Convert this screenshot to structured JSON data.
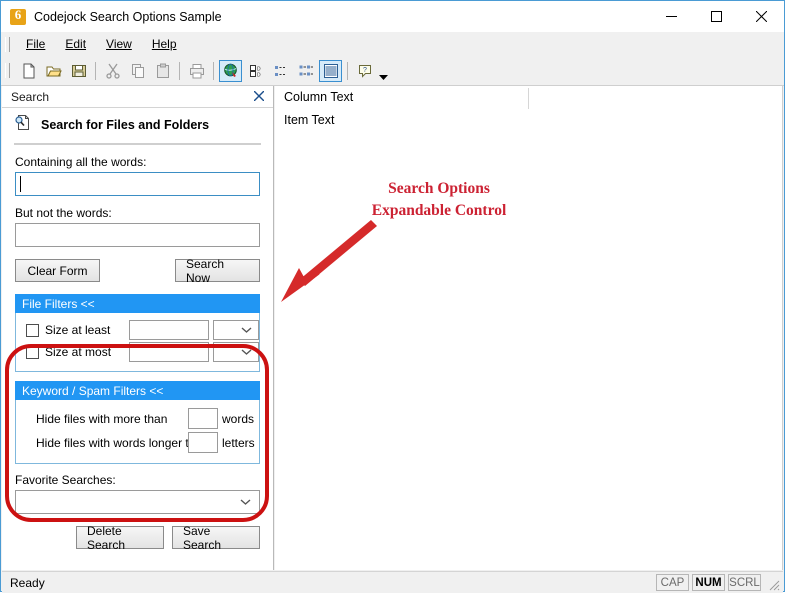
{
  "window": {
    "title": "Codejock Search Options Sample",
    "app_icon": "codejock-logo-icon",
    "minimize_label": "Minimize",
    "maximize_label": "Maximize",
    "close_label": "Close"
  },
  "menubar": {
    "items": [
      {
        "label": "File",
        "accel": "F"
      },
      {
        "label": "Edit",
        "accel": "E"
      },
      {
        "label": "View",
        "accel": "V"
      },
      {
        "label": "Help",
        "accel": "H"
      }
    ]
  },
  "toolbar": {
    "buttons": [
      {
        "name": "new-icon",
        "title": "New"
      },
      {
        "name": "open-icon",
        "title": "Open"
      },
      {
        "name": "save-icon",
        "title": "Save"
      },
      {
        "name": "cut-icon",
        "title": "Cut"
      },
      {
        "name": "copy-icon",
        "title": "Copy"
      },
      {
        "name": "paste-icon",
        "title": "Paste"
      },
      {
        "name": "print-icon",
        "title": "Print"
      },
      {
        "name": "globe-icon",
        "title": "Web"
      },
      {
        "name": "large-icons-icon",
        "title": "Large Icons"
      },
      {
        "name": "small-icons-icon",
        "title": "Small Icons"
      },
      {
        "name": "list-icon",
        "title": "List"
      },
      {
        "name": "details-icon",
        "title": "Details"
      },
      {
        "name": "help-icon",
        "title": "Help"
      }
    ],
    "dropdown_label": "More"
  },
  "search_pane": {
    "caption": "Search",
    "close_label": "Close",
    "header_title": "Search for Files and Folders",
    "header_icon": "search-document-icon",
    "containing_label": "Containing all the words:",
    "containing_value": "",
    "not_words_label": "But not the words:",
    "not_words_value": "",
    "clear_form_label": "Clear Form",
    "search_now_label": "Search Now",
    "file_filters": {
      "title": "File Filters <<",
      "rows": [
        {
          "label": "Size at least",
          "checked": false,
          "value": "",
          "unit": ""
        },
        {
          "label": "Size at most",
          "checked": false,
          "value": "",
          "unit": ""
        }
      ]
    },
    "keyword_filters": {
      "title": "Keyword / Spam Filters <<",
      "rows": [
        {
          "label": "Hide files with more than",
          "value": "",
          "unit": "words"
        },
        {
          "label": "Hide files with words longer than",
          "value": "",
          "unit": "letters"
        }
      ]
    },
    "favorites_label": "Favorite Searches:",
    "favorites_value": "",
    "delete_search_label": "Delete Search",
    "save_search_label": "Save Search"
  },
  "content": {
    "column_text": "Column Text",
    "item_text": "Item Text",
    "annotation_line1": "Search Options",
    "annotation_line2": "Expandable Control",
    "annotation_color": "#cc2233"
  },
  "statusbar": {
    "text": "Ready",
    "indicators": [
      {
        "label": "CAP",
        "active": false
      },
      {
        "label": "NUM",
        "active": true
      },
      {
        "label": "SCRL",
        "active": false
      }
    ]
  },
  "colors": {
    "group_header": "#2196f3",
    "highlight": "#cc1111",
    "accent_border": "#4a9bd4"
  }
}
